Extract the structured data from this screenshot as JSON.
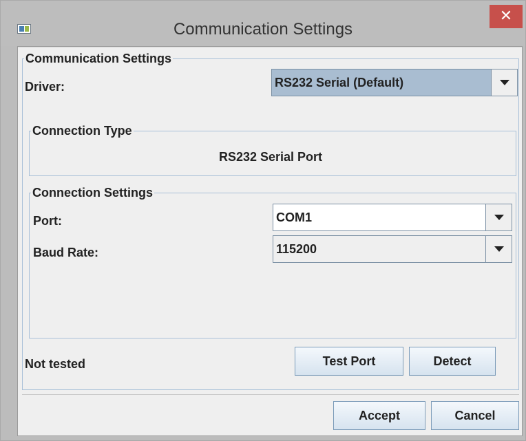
{
  "window": {
    "title": "Communication Settings",
    "close_label": "✕"
  },
  "group_main": {
    "legend": "Communication Settings"
  },
  "driver": {
    "label": "Driver:",
    "value": "RS232 Serial (Default)"
  },
  "connection_type": {
    "legend": "Connection Type",
    "value": "RS232 Serial Port"
  },
  "connection_settings": {
    "legend": "Connection Settings",
    "port": {
      "label": "Port:",
      "value": "COM1"
    },
    "baud": {
      "label": "Baud Rate:",
      "value": "115200"
    }
  },
  "status": {
    "text": "Not tested"
  },
  "buttons": {
    "test_port": "Test Port",
    "detect": "Detect",
    "accept": "Accept",
    "cancel": "Cancel"
  },
  "colors": {
    "titlebar": "#bdbdbd",
    "close": "#c7504b",
    "driver_combo": "#a9bdd1",
    "panel": "#efefef"
  }
}
